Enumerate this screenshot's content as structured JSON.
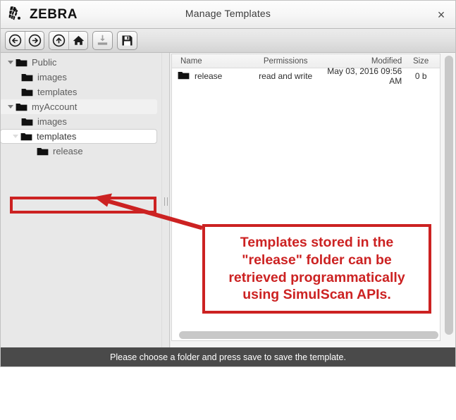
{
  "window": {
    "brand": "ZEBRA",
    "title": "Manage Templates",
    "close_label": "×"
  },
  "toolbar": {
    "buttons": [
      {
        "name": "back-button",
        "icon": "arrow-left-circle-icon",
        "tooltip": "Back",
        "enabled": true
      },
      {
        "name": "forward-button",
        "icon": "arrow-right-circle-icon",
        "tooltip": "Forward",
        "enabled": true
      },
      {
        "name": "up-button",
        "icon": "arrow-up-circle-icon",
        "tooltip": "Up",
        "enabled": true
      },
      {
        "name": "home-button",
        "icon": "home-icon",
        "tooltip": "Home",
        "enabled": true
      },
      {
        "name": "import-button",
        "icon": "import-icon",
        "tooltip": "Import",
        "enabled": false
      },
      {
        "name": "save-button",
        "icon": "floppy-disk-icon",
        "tooltip": "Save",
        "enabled": true
      }
    ]
  },
  "tree": {
    "items": [
      {
        "label": "Public",
        "depth": 0,
        "expanded": true,
        "selected": false,
        "highlighted": false
      },
      {
        "label": "images",
        "depth": 1,
        "expanded": null,
        "selected": false,
        "highlighted": false
      },
      {
        "label": "templates",
        "depth": 1,
        "expanded": null,
        "selected": false,
        "highlighted": false
      },
      {
        "label": "myAccount",
        "depth": 0,
        "expanded": true,
        "selected": false,
        "highlighted": true
      },
      {
        "label": "images",
        "depth": 1,
        "expanded": null,
        "selected": false,
        "highlighted": false
      },
      {
        "label": "templates",
        "depth": 1,
        "expanded": true,
        "selected": true,
        "highlighted": false
      },
      {
        "label": "release",
        "depth": 2,
        "expanded": null,
        "selected": false,
        "highlighted": false
      }
    ]
  },
  "file_list": {
    "columns": [
      "Name",
      "Permissions",
      "Modified",
      "Size"
    ],
    "rows": [
      {
        "name": "release",
        "permissions": "read and write",
        "modified": "May 03, 2016 09:56 AM",
        "size": "0 b",
        "icon": "folder-icon"
      }
    ]
  },
  "annotation": {
    "callout_text": "Templates stored in the\n\"release\" folder can be\nretrieved programmatically\nusing SimulScan APIs.",
    "highlight_target": "release",
    "color": "#cc2222"
  },
  "status_bar": {
    "message": "Please choose a folder and press save to save the template."
  },
  "colors": {
    "status_background": "#4a4a4a",
    "annotation_red": "#cc2222",
    "panel_background": "#e8e8e8",
    "list_background": "#ffffff"
  }
}
